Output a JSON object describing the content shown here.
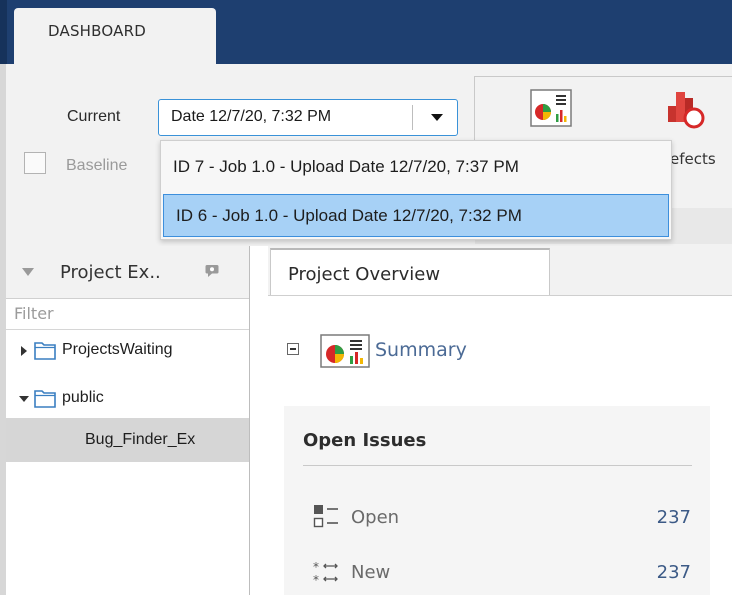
{
  "ribbon": {
    "tab_label": "DASHBOARD",
    "current_label": "Current",
    "current_value": "Date 12/7/20, 7:32 PM",
    "baseline_label": "Baseline",
    "defects_label": "efects",
    "dropdown_options": [
      "ID 7 - Job 1.0 - Upload Date 12/7/20, 7:37 PM",
      "ID 6 - Job 1.0 - Upload Date 12/7/20, 7:32 PM"
    ],
    "selected_option_index": 1
  },
  "project_explorer": {
    "title": "Project Ex..",
    "filter_placeholder": "Filter",
    "tree": [
      {
        "label": "ProjectsWaiting",
        "expanded": false
      },
      {
        "label": "public",
        "expanded": true
      },
      {
        "label": "Bug_Finder_Ex",
        "selected": true
      }
    ]
  },
  "overview": {
    "tab_label": "Project Overview",
    "summary_label": "Summary",
    "open_issues_title": "Open Issues",
    "issues": [
      {
        "label": "Open",
        "count": "237",
        "icon": "open-issues-icon"
      },
      {
        "label": "New",
        "count": "237",
        "icon": "new-issues-icon"
      }
    ]
  },
  "colors": {
    "ribbon_blue": "#1e3f70",
    "selection_blue": "#a7d1f6",
    "link_blue": "#4b6a95"
  }
}
